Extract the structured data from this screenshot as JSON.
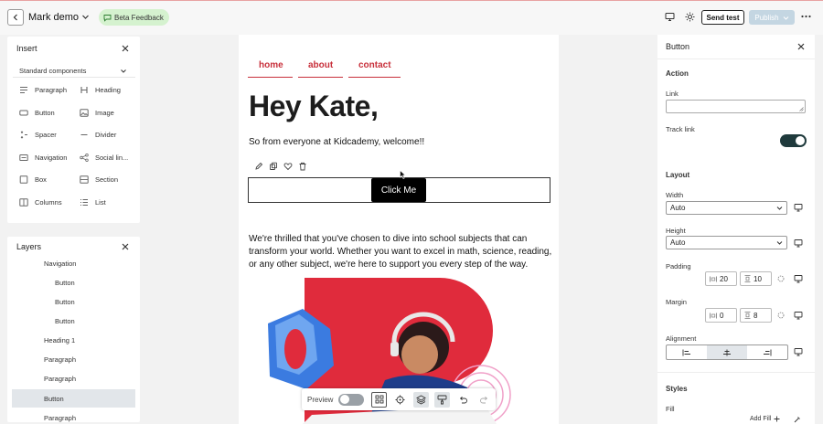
{
  "topbar": {
    "title": "Mark demo",
    "beta_label": "Beta Feedback",
    "send_test_label": "Send test",
    "publish_label": "Publish"
  },
  "insert_panel": {
    "title": "Insert",
    "section_label": "Standard components",
    "components": [
      {
        "label": "Paragraph",
        "icon": "paragraph-icon"
      },
      {
        "label": "Heading",
        "icon": "heading-icon"
      },
      {
        "label": "Button",
        "icon": "button-icon"
      },
      {
        "label": "Image",
        "icon": "image-icon"
      },
      {
        "label": "Spacer",
        "icon": "spacer-icon"
      },
      {
        "label": "Divider",
        "icon": "divider-icon"
      },
      {
        "label": "Navigation",
        "icon": "navigation-icon"
      },
      {
        "label": "Social lin...",
        "icon": "share-icon"
      },
      {
        "label": "Box",
        "icon": "box-icon"
      },
      {
        "label": "Section",
        "icon": "section-icon"
      },
      {
        "label": "Columns",
        "icon": "columns-icon"
      },
      {
        "label": "List",
        "icon": "list-icon"
      }
    ]
  },
  "layers_panel": {
    "title": "Layers",
    "items": [
      {
        "label": "Navigation",
        "depth": 1,
        "selected": false
      },
      {
        "label": "Button",
        "depth": 2,
        "selected": false
      },
      {
        "label": "Button",
        "depth": 2,
        "selected": false
      },
      {
        "label": "Button",
        "depth": 2,
        "selected": false
      },
      {
        "label": "Heading 1",
        "depth": 1,
        "selected": false
      },
      {
        "label": "Paragraph",
        "depth": 1,
        "selected": false
      },
      {
        "label": "Paragraph",
        "depth": 1,
        "selected": false
      },
      {
        "label": "Button",
        "depth": 1,
        "selected": true
      },
      {
        "label": "Paragraph",
        "depth": 1,
        "selected": false
      }
    ]
  },
  "email": {
    "nav": [
      "home",
      "about",
      "contact"
    ],
    "heading": "Hey Kate,",
    "intro": "So from everyone at Kidcademy, welcome!!",
    "button_label": "Click Me",
    "body": "We're thrilled that you've chosen to dive into school subjects that can transform your world. Whether you want to excel in math, science, reading, or any other subject, we're here to support you every step of the way."
  },
  "bottom_toolbar": {
    "preview_label": "Preview",
    "preview_on": false
  },
  "properties": {
    "title": "Button",
    "action_section": "Action",
    "link_label": "Link",
    "link_value": "",
    "track_link_label": "Track link",
    "track_link_on": true,
    "layout_section": "Layout",
    "width_label": "Width",
    "width_value": "Auto",
    "height_label": "Height",
    "height_value": "Auto",
    "padding_label": "Padding",
    "padding_h": "20",
    "padding_v": "10",
    "margin_label": "Margin",
    "margin_h": "0",
    "margin_v": "8",
    "alignment_label": "Alignment",
    "alignment_selected": "center",
    "styles_section": "Styles",
    "fill_label": "Fill",
    "add_fill_label": "Add Fill"
  },
  "colors": {
    "accent_red": "#c8303b",
    "toggle_on": "#1f3a3c",
    "publish_disabled": "#c4d6e2",
    "beta_bg": "#d5f2cf"
  }
}
